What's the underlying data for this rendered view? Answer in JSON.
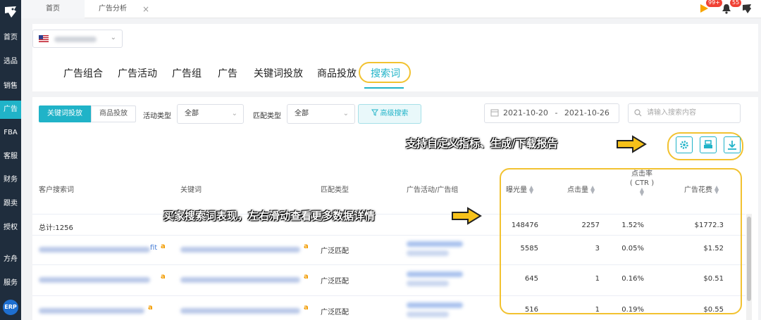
{
  "sidebar": {
    "items": [
      "首页",
      "选品",
      "销售",
      "广告",
      "FBA",
      "客服",
      "财务",
      "跟卖",
      "授权",
      "方舟",
      "服务"
    ],
    "erp": "ERP"
  },
  "topbar": {
    "tabs": [
      "首页",
      "广告分析"
    ],
    "badge_notice": "99+",
    "badge_bell": "55"
  },
  "nav": {
    "tabs": [
      "广告组合",
      "广告活动",
      "广告组",
      "广告",
      "关键词投放",
      "商品投放",
      "搜索词"
    ],
    "active": "搜索词"
  },
  "filters": {
    "seg_keyword": "关键词投放",
    "seg_product": "商品投放",
    "activity_label": "活动类型",
    "activity_value": "全部",
    "match_label": "匹配类型",
    "match_value": "全部",
    "advanced": "高级搜索",
    "date_start": "2021-10-20",
    "date_sep": "-",
    "date_end": "2021-10-26",
    "search_placeholder": "请输入搜索内容"
  },
  "annotations": {
    "tools": "支持自定义指标、生成/下载报告",
    "table": "买家搜索词表现，左右滑动查看更多数据详情"
  },
  "table": {
    "headers": {
      "search_term": "客户搜索词",
      "keyword": "关键词",
      "match_type": "匹配类型",
      "campaign": "广告活动/广告组",
      "impressions": "曝光量",
      "clicks": "点击量",
      "ctr_line1": "点击率",
      "ctr_line2": "( CTR )",
      "spend": "广告花费"
    },
    "total": {
      "label": "总计:1256",
      "impressions": "148476",
      "clicks": "2257",
      "ctr": "1.52%",
      "spend": "$1772.3"
    },
    "rows": [
      {
        "term_tail": "fit",
        "match": "广泛匹配",
        "impressions": "5585",
        "clicks": "3",
        "ctr": "0.05%",
        "spend": "$1.52"
      },
      {
        "term_tail": "",
        "match": "广泛匹配",
        "impressions": "645",
        "clicks": "1",
        "ctr": "0.16%",
        "spend": "$0.51"
      },
      {
        "term_tail": "",
        "match": "广泛匹配",
        "impressions": "516",
        "clicks": "1",
        "ctr": "0.19%",
        "spend": "$0.55"
      }
    ]
  },
  "colors": {
    "accent": "#20b3c8",
    "highlight": "#f2c230",
    "sidebar": "#1f2d3d"
  },
  "icons": [
    "logo-icon",
    "notice-flag-icon",
    "bell-icon",
    "owl-avatar-icon",
    "us-flag-icon",
    "filter-icon",
    "calendar-icon",
    "search-icon",
    "gear-icon",
    "print-icon",
    "download-icon",
    "arrow-right-icon",
    "amazon-icon"
  ]
}
